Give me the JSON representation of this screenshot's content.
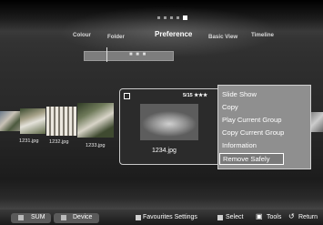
{
  "nav": {
    "tabs": [
      {
        "label": "Colour"
      },
      {
        "label": "Folder"
      },
      {
        "label": "Preference"
      },
      {
        "label": "Basic View"
      },
      {
        "label": "Timeline"
      }
    ],
    "dots": 5,
    "active_dot": 4
  },
  "filter": {
    "text": "■ ■ ■"
  },
  "thumbnails": [
    {
      "label": ""
    },
    {
      "label": "1231.jpg"
    },
    {
      "label": "1232.jpg"
    },
    {
      "label": "1233.jpg"
    }
  ],
  "selected": {
    "rating": "5/15 ★★★",
    "name": "1234.jpg"
  },
  "menu": {
    "items": [
      {
        "label": "Slide Show"
      },
      {
        "label": "Copy"
      },
      {
        "label": "Play Current Group"
      },
      {
        "label": "Copy Current Group"
      },
      {
        "label": "Information"
      },
      {
        "label": "Remove Safely"
      }
    ],
    "selected_index": 5
  },
  "bottom": {
    "sum": "SUM",
    "device": "Device",
    "favourites": "Favourites Settings",
    "select": "Select",
    "tools": "Tools",
    "return": "Return"
  },
  "colors": {
    "menu_bg": "#8f8f8f",
    "menu_border": "#d0d0d0"
  }
}
